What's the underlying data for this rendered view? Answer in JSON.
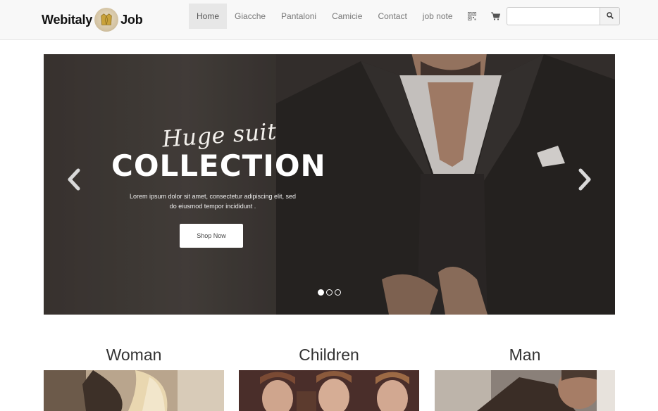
{
  "brand": {
    "left_text": "Webitaly",
    "right_text": "Job",
    "logo_icon": "jacket-logo-icon"
  },
  "nav": {
    "items": [
      {
        "label": "Home",
        "active": true
      },
      {
        "label": "Giacche"
      },
      {
        "label": "Pantaloni"
      },
      {
        "label": "Camicie"
      },
      {
        "label": "Contact"
      },
      {
        "label": "job note"
      }
    ],
    "icons": [
      "qrcode-icon",
      "cart-icon"
    ]
  },
  "search": {
    "placeholder": "",
    "value": "",
    "button_icon": "search-icon"
  },
  "carousel": {
    "script_title": "Huge suit",
    "headline": "COLLECTION",
    "text": "Lorem ipsum dolor sit amet, consectetur adipiscing elit, sed do eiusmod tempor incididunt .",
    "button": "Shop Now",
    "slides": 3,
    "active_slide": 1
  },
  "categories": [
    {
      "title": "Woman"
    },
    {
      "title": "Children"
    },
    {
      "title": "Man"
    }
  ],
  "colors": {
    "navbar_bg": "#f8f8f8",
    "active_nav_bg": "#e7e7e7",
    "text_dark": "#333333"
  }
}
